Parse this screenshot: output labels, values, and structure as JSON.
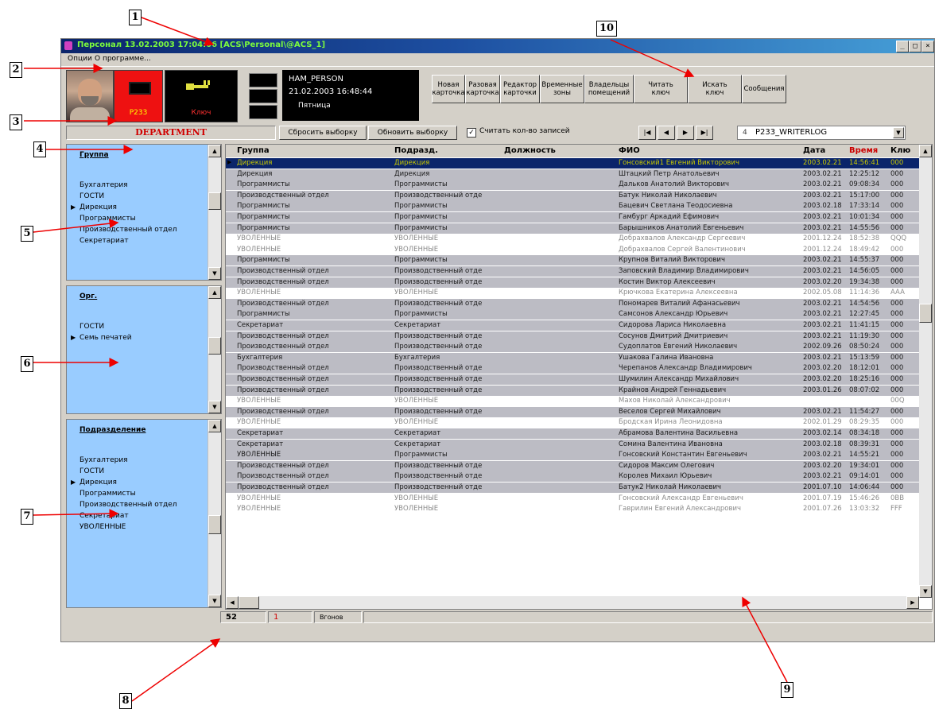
{
  "window": {
    "title": "Персонал 13.02.2003 17:04:06 [ACS\\Personal\\@ACS_1]",
    "controls": [
      "_",
      "□",
      "×"
    ]
  },
  "menu": {
    "item1": "Опции",
    "item2": "О программе..."
  },
  "toolbar": {
    "card_label": "P233",
    "key_label": "Ключ",
    "info_name": "HAM_PERSON",
    "info_datetime": "21.02.2003 16:48:44",
    "info_day": "Пятница",
    "buttons": [
      {
        "l1": "Новая",
        "l2": "карточка"
      },
      {
        "l1": "Разовая",
        "l2": "карточка"
      },
      {
        "l1": "Редактор",
        "l2": "карточки"
      },
      {
        "l1": "Временные",
        "l2": "зоны"
      },
      {
        "l1": "Владельцы",
        "l2": "помещений"
      },
      {
        "l1": "Читать",
        "l2": "ключ"
      },
      {
        "l1": "Искать",
        "l2": "ключ"
      },
      {
        "l1": "Сообщения",
        "l2": ""
      }
    ]
  },
  "filterbar": {
    "department": "DEPARTMENT",
    "reset_label": "Сбросить выборку",
    "refresh_label": "Обновить выборку",
    "count_check": "✓",
    "count_label": "Считать кол-во записей",
    "nav": [
      "|◀",
      "◀",
      "▶",
      "▶|"
    ],
    "combo_num": "4",
    "combo_value": "P233_WRITERLOG"
  },
  "panels": {
    "group": {
      "header": "Группа",
      "items": [
        "Бухгалтерия",
        "ГОСТИ",
        "Дирекция",
        "Программисты",
        "Производственный отдел",
        "Секретариат"
      ]
    },
    "org": {
      "header": "Орг.",
      "items": [
        "ГОСТИ",
        "Семь печатей"
      ]
    },
    "division": {
      "header": "Подразделение",
      "items": [
        "Бухгалтерия",
        "ГОСТИ",
        "Дирекция",
        "Программисты",
        "Производственный отдел",
        "Секретариат",
        "УВОЛЕННЫЕ"
      ]
    }
  },
  "grid": {
    "columns": [
      "Группа",
      "Подразд.",
      "Должность",
      "ФИО",
      "Дата",
      "Время",
      "Клю"
    ],
    "rows": [
      {
        "t": "sel",
        "c": [
          "Дирекция",
          "Дирекция",
          "",
          "Гонсовский1 Евгений Викторович",
          "2003.02.21",
          "14:56:41",
          "000"
        ]
      },
      {
        "t": "gray",
        "c": [
          "Дирекция",
          "Дирекция",
          "",
          "Штацкий Петр Анатольевич",
          "2003.02.21",
          "12:25:12",
          "000"
        ]
      },
      {
        "t": "gray",
        "c": [
          "Программисты",
          "Программисты",
          "",
          "Дальков Анатолий Викторович",
          "2003.02.21",
          "09:08:34",
          "000"
        ]
      },
      {
        "t": "gray",
        "c": [
          "Производственный отдел",
          "Производственный отде",
          "",
          "Батук Николай Николаевич",
          "2003.02.21",
          "15:17:00",
          "000"
        ]
      },
      {
        "t": "gray",
        "c": [
          "Программисты",
          "Программисты",
          "",
          "Бацевич Светлана Теодосиевна",
          "2003.02.18",
          "17:33:14",
          "000"
        ]
      },
      {
        "t": "gray",
        "c": [
          "Программисты",
          "Программисты",
          "",
          "Гамбург Аркадий Ефимович",
          "2003.02.21",
          "10:01:34",
          "000"
        ]
      },
      {
        "t": "gray",
        "c": [
          "Программисты",
          "Программисты",
          "",
          "Барышников Анатолий Евгеньевич",
          "2003.02.21",
          "14:55:56",
          "000"
        ]
      },
      {
        "t": "white",
        "c": [
          "УВОЛЕННЫЕ",
          "УВОЛЕННЫЕ",
          "",
          "Добрахвалов Александр Сергеевич",
          "2001.12.24",
          "18:52:38",
          "QQQ"
        ]
      },
      {
        "t": "white",
        "c": [
          "УВОЛЕННЫЕ",
          "УВОЛЕННЫЕ",
          "",
          "Добрахвалов Сергей Валентинович",
          "2001.12.24",
          "18:49:42",
          "000"
        ]
      },
      {
        "t": "gray",
        "c": [
          "Программисты",
          "Программисты",
          "",
          "Крупнов Виталий Викторович",
          "2003.02.21",
          "14:55:37",
          "000"
        ]
      },
      {
        "t": "gray",
        "c": [
          "Производственный отдел",
          "Производственный отде",
          "",
          "Заповский Владимир Владимирович",
          "2003.02.21",
          "14:56:05",
          "000"
        ]
      },
      {
        "t": "gray",
        "c": [
          "Производственный отдел",
          "Производственный отде",
          "",
          "Костин Виктор Алексеевич",
          "2003.02.20",
          "19:34:38",
          "000"
        ]
      },
      {
        "t": "white",
        "c": [
          "УВОЛЕННЫЕ",
          "УВОЛЕННЫЕ",
          "",
          "Крючкова Екатерина Алексеевна",
          "2002.05.08",
          "11:14:36",
          "AAA"
        ]
      },
      {
        "t": "gray",
        "c": [
          "Производственный отдел",
          "Производственный отде",
          "",
          "Пономарев Виталий Афанасьевич",
          "2003.02.21",
          "14:54:56",
          "000"
        ]
      },
      {
        "t": "gray",
        "c": [
          "Программисты",
          "Программисты",
          "",
          "Самсонов Александр Юрьевич",
          "2003.02.21",
          "12:27:45",
          "000"
        ]
      },
      {
        "t": "gray",
        "c": [
          "Секретариат",
          "Секретариат",
          "",
          "Сидорова Лариса Николаевна",
          "2003.02.21",
          "11:41:15",
          "000"
        ]
      },
      {
        "t": "gray",
        "c": [
          "Производственный отдел",
          "Производственный отде",
          "",
          "Сосунов Дмитрий Дмитриевич",
          "2003.02.21",
          "11:19:30",
          "000"
        ]
      },
      {
        "t": "gray",
        "c": [
          "Производственный отдел",
          "Производственный отде",
          "",
          "Судоплатов Евгений Николаевич",
          "2002.09.26",
          "08:50:24",
          "000"
        ]
      },
      {
        "t": "gray",
        "c": [
          "Бухгалтерия",
          "Бухгалтерия",
          "",
          "Ушакова Галина Ивановна",
          "2003.02.21",
          "15:13:59",
          "000"
        ]
      },
      {
        "t": "gray",
        "c": [
          "Производственный отдел",
          "Производственный отде",
          "",
          "Черепанов Александр Владимирович",
          "2003.02.20",
          "18:12:01",
          "000"
        ]
      },
      {
        "t": "gray",
        "c": [
          "Производственный отдел",
          "Производственный отде",
          "",
          "Шумилин Александр Михайлович",
          "2003.02.20",
          "18:25:16",
          "000"
        ]
      },
      {
        "t": "gray",
        "c": [
          "Производственный отдел",
          "Производственный отде",
          "",
          "Крайнов Андрей Геннадьевич",
          "2003.01.26",
          "08:07:02",
          "000"
        ]
      },
      {
        "t": "white",
        "c": [
          "УВОЛЕННЫЕ",
          "УВОЛЕННЫЕ",
          "",
          "Махов Николай Александрович",
          "",
          "",
          "00Q"
        ]
      },
      {
        "t": "gray",
        "c": [
          "Производственный отдел",
          "Производственный отде",
          "",
          "Веселов Сергей Михайлович",
          "2003.02.21",
          "11:54:27",
          "000"
        ]
      },
      {
        "t": "white",
        "c": [
          "УВОЛЕННЫЕ",
          "УВОЛЕННЫЕ",
          "",
          "Бродская Ирина Леонидовна",
          "2002.01.29",
          "08:29:35",
          "000"
        ]
      },
      {
        "t": "gray",
        "c": [
          "Секретариат",
          "Секретариат",
          "",
          "Абрамова Валентина Васильевна",
          "2003.02.14",
          "08:34:18",
          "000"
        ]
      },
      {
        "t": "gray",
        "c": [
          "Секретариат",
          "Секретариат",
          "",
          "Сомина Валентина Ивановна",
          "2003.02.18",
          "08:39:31",
          "000"
        ]
      },
      {
        "t": "gray",
        "c": [
          "УВОЛЕННЫЕ",
          "Программисты",
          "",
          "Гонсовский Константин Евгеньевич",
          "2003.02.21",
          "14:55:21",
          "000"
        ]
      },
      {
        "t": "gray",
        "c": [
          "Производственный отдел",
          "Производственный отде",
          "",
          "Сидоров Максим Олегович",
          "2003.02.20",
          "19:34:01",
          "000"
        ]
      },
      {
        "t": "gray",
        "c": [
          "Производственный отдел",
          "Производственный отде",
          "",
          "Королев Михаил Юрьевич",
          "2003.02.21",
          "09:14:01",
          "000"
        ]
      },
      {
        "t": "gray",
        "c": [
          "Производственный отдел",
          "Производственный отде",
          "",
          "Батук2 Николай Николаевич",
          "2001.07.10",
          "14:06:44",
          "000"
        ]
      },
      {
        "t": "white",
        "c": [
          "УВОЛЕННЫЕ",
          "УВОЛЕННЫЕ",
          "",
          "Гонсовский Александр Евгеньевич",
          "2001.07.19",
          "15:46:26",
          "0BB"
        ]
      },
      {
        "t": "white",
        "c": [
          "УВОЛЕННЫЕ",
          "УВОЛЕННЫЕ",
          "",
          "Гаврилин Евгений Александрович",
          "2001.07.26",
          "13:03:32",
          "FFF"
        ]
      }
    ]
  },
  "statusbar": {
    "count": "52",
    "red": "1",
    "text": "Вгонов"
  },
  "callouts": [
    "1",
    "2",
    "3",
    "4",
    "5",
    "6",
    "7",
    "8",
    "9",
    "10"
  ],
  "colors": {
    "selected_row": "#0a246a",
    "panel_bg": "#99ccff",
    "time_header": "#cc0000",
    "card_red": "#ee1111"
  }
}
